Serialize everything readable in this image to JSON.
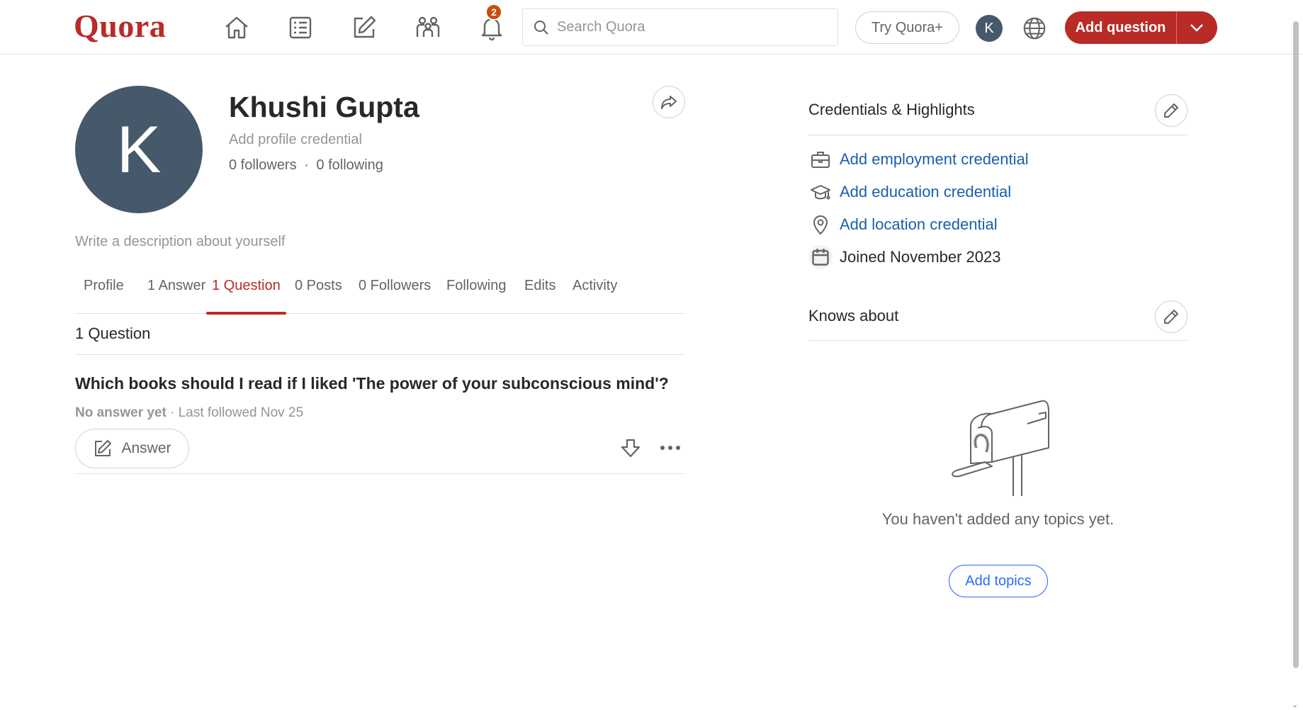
{
  "header": {
    "logo": "Quora",
    "nav": [
      {
        "name": "home-icon"
      },
      {
        "name": "following-feed-icon"
      },
      {
        "name": "answer-pencil-icon"
      },
      {
        "name": "spaces-icon"
      },
      {
        "name": "notifications-bell-icon"
      }
    ],
    "notification_count": "2",
    "search_placeholder": "Search Quora",
    "try_plus_label": "Try Quora+",
    "avatar_initial": "K",
    "add_question_label": "Add question",
    "colors": {
      "brand": "#b92b27",
      "avatar": "#45596b",
      "badge": "#cb4b10"
    }
  },
  "profile": {
    "avatar_initial": "K",
    "name": "Khushi Gupta",
    "add_credential": "Add profile credential",
    "followers": "0 followers",
    "separator": "·",
    "following": "0 following",
    "description_placeholder": "Write a description about yourself",
    "tabs": [
      {
        "label": "Profile",
        "active": false
      },
      {
        "label": "1 Answer",
        "active": false
      },
      {
        "label": "1 Question",
        "active": true
      },
      {
        "label": "0 Posts",
        "active": false
      },
      {
        "label": "0 Followers",
        "active": false
      },
      {
        "label": "Following",
        "active": false
      },
      {
        "label": "Edits",
        "active": false
      },
      {
        "label": "Activity",
        "active": false
      }
    ]
  },
  "questions": {
    "heading": "1 Question",
    "items": [
      {
        "title": "Which books should I read if I liked 'The power of your subconscious mind'?",
        "status": "No answer yet",
        "meta": " · Last followed Nov 25",
        "answer_label": "Answer"
      }
    ]
  },
  "credentials": {
    "heading": "Credentials & Highlights",
    "items": [
      {
        "icon": "briefcase-icon",
        "label": "Add employment credential"
      },
      {
        "icon": "graduation-cap-icon",
        "label": "Add education credential"
      },
      {
        "icon": "location-pin-icon",
        "label": "Add location credential"
      },
      {
        "icon": "calendar-icon",
        "label": "Joined November 2023"
      }
    ]
  },
  "knows_about": {
    "heading": "Knows about",
    "empty_text": "You haven't added any topics yet.",
    "add_label": "Add topics",
    "accent": "#2e69ff"
  }
}
